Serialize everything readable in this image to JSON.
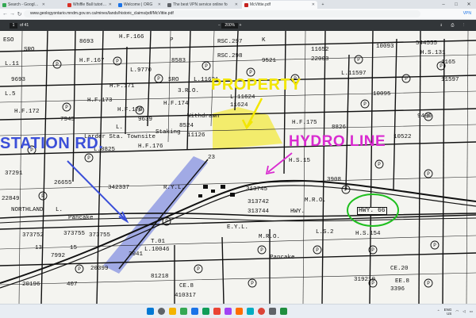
{
  "tabs": [
    {
      "label": "Search - Google Profiles",
      "favicon_color": "#34a853",
      "active": false
    },
    {
      "label": "Whiffle Ball tutorial - FreeCAD",
      "favicon_color": "#d93025",
      "active": false
    },
    {
      "label": "Welcome | ORG",
      "favicon_color": "#1a73e8",
      "active": false
    },
    {
      "label": "The best VPN service online fo",
      "favicon_color": "#5f6368",
      "active": false
    },
    {
      "label": "McVittie.pdf",
      "favicon_color": "#c5221f",
      "active": true
    }
  ],
  "window_controls": {
    "minimize": "–",
    "maximize": "□",
    "close": "✕"
  },
  "address": {
    "back": "←",
    "forward": "→",
    "reload": "↻",
    "url": "www.geologyontario.mndm.gov.on.ca/mines/lands/historic_claims/pdf/McVittie.pdf",
    "vpn": "VPN"
  },
  "pdf_toolbar": {
    "page_current": "1",
    "page_total": "of 41",
    "zoom": "200%",
    "tools_glyphs": "⭳ ⎙ ⋮"
  },
  "map": {
    "annotations": {
      "property": "PROPERTY",
      "station_rd": "STATION RD.",
      "hydro_line": "HYDRO LINE",
      "hwy": "HWY. 66"
    },
    "parcel_labels": [
      "ESO",
      "SRO",
      "8693",
      "H.F.166",
      "P",
      "RSC.297",
      "K",
      "RSC.298",
      "11652",
      "22003",
      "10093",
      "544555",
      "H.S.131",
      "1165",
      "9693",
      "L.9770",
      "H.F.167",
      "8583",
      "9521",
      "L.11597",
      "11597",
      "SRO",
      "L.11",
      "L.5",
      "H.F.171",
      "L.11621",
      "3.R.O.",
      "10095",
      "9496",
      "H.F.172",
      "7945",
      "L.11624",
      "11624",
      "H.F.170",
      "H.F.173",
      "H.F.174",
      "9639",
      "8826",
      "Larder Sta. Townsite",
      "L.",
      "H.F.175",
      "H.F.176",
      "Withdrawn",
      "Staking",
      "8524",
      "11126",
      "10522",
      "L.8825",
      "23",
      "H.S.15",
      "3908",
      "37291",
      "26655",
      "342337",
      "R.Y.L.",
      "313745",
      "22849",
      "NORTHLAND",
      "L.",
      "313742",
      "M.R.O.",
      "HWY.",
      "Pancake",
      "373752",
      "373755",
      "373755",
      "313744",
      "E.Y.L.",
      "L.S.2",
      "H.S.154",
      "7992",
      "T.01",
      "M.R.O.",
      "13",
      "15",
      "20399",
      "3041",
      "L.10046",
      "CE.20",
      "319210",
      "81218",
      "Pancake",
      "CE.8",
      "410317",
      "407",
      "20196",
      "EE.8",
      "3396"
    ]
  },
  "taskbar": {
    "icons": [
      {
        "name": "windows-start-icon",
        "color": "#0078d4"
      },
      {
        "name": "search-icon",
        "color": "#5f6368"
      },
      {
        "name": "file-explorer-icon",
        "color": "#f4b400"
      },
      {
        "name": "browser-icon",
        "color": "#34a853"
      },
      {
        "name": "mail-icon",
        "color": "#1a73e8"
      },
      {
        "name": "edge-icon",
        "color": "#0f9d58"
      },
      {
        "name": "app-icon",
        "color": "#ea4335"
      },
      {
        "name": "app-icon-2",
        "color": "#a142f4"
      },
      {
        "name": "app-icon-3",
        "color": "#ff6d00"
      },
      {
        "name": "app-icon-4",
        "color": "#00acc1"
      },
      {
        "name": "chrome-icon",
        "color": "#db4437"
      },
      {
        "name": "app-icon-5",
        "color": "#5f6368"
      },
      {
        "name": "app-icon-6",
        "color": "#1e8e3e"
      }
    ],
    "tray": {
      "language_top": "ENG",
      "language_bottom": "US",
      "time": "",
      "date": ""
    }
  },
  "colors": {
    "property_highlight": "#f2e600",
    "station_rd_highlight": "#3b4fd8",
    "hydro_line": "#d92bd0",
    "hwy_circle": "#1fbf1f"
  }
}
